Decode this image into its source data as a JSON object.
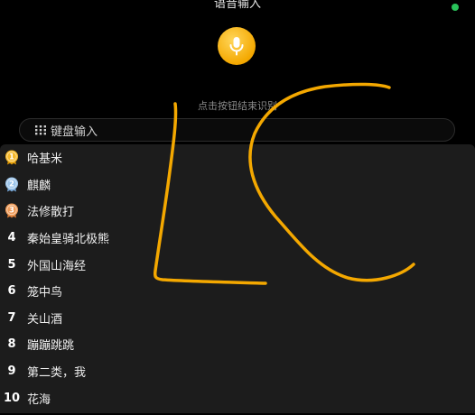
{
  "header": {
    "title": "语音输入"
  },
  "colors": {
    "accent": "#f4a800",
    "status": "#29c35a",
    "scribble": "#f4a800"
  },
  "mic": {
    "icon": "microphone-icon"
  },
  "hint": "点击按钮结束识别",
  "keyboard_bar": {
    "icon": "keyboard-grid-icon",
    "label": "键盘输入"
  },
  "list": [
    {
      "rank": "1",
      "name": "哈基米",
      "medal": "gold"
    },
    {
      "rank": "2",
      "name": "麒麟",
      "medal": "silver"
    },
    {
      "rank": "3",
      "name": "法修散打",
      "medal": "bronze"
    },
    {
      "rank": "4",
      "name": "秦始皇骑北极熊"
    },
    {
      "rank": "5",
      "name": "外国山海经"
    },
    {
      "rank": "6",
      "name": "笼中鸟"
    },
    {
      "rank": "7",
      "name": "关山酒"
    },
    {
      "rank": "8",
      "name": "蹦蹦跳跳"
    },
    {
      "rank": "9",
      "name": "第二类，我"
    },
    {
      "rank": "10",
      "name": "花海"
    }
  ]
}
